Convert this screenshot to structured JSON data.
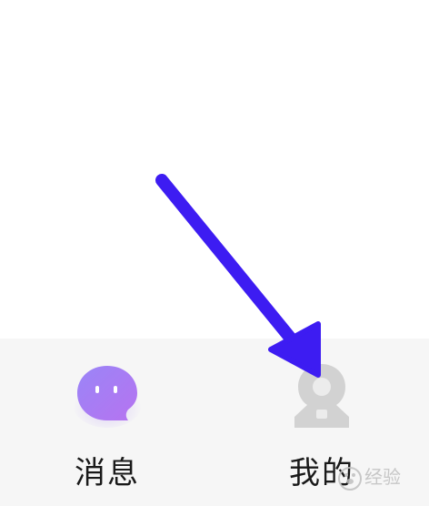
{
  "tab_bar": {
    "messages": {
      "label": "消息",
      "icon": "chat-bubble-icon"
    },
    "mine": {
      "label": "我的",
      "icon": "profile-person-icon"
    }
  },
  "annotation": {
    "icon": "pointer-arrow-icon",
    "color": "#3d1cf2"
  },
  "watermark": {
    "text": "经验"
  },
  "colors": {
    "tab_bar_background": "#f6f6f6",
    "messages_icon_gradient_start": "#9a85f7",
    "messages_icon_gradient_end": "#b673f0",
    "mine_icon_inactive": "#d2d2d2",
    "label_text": "#1a1a1a",
    "annotation_arrow": "#3d1cf2"
  }
}
